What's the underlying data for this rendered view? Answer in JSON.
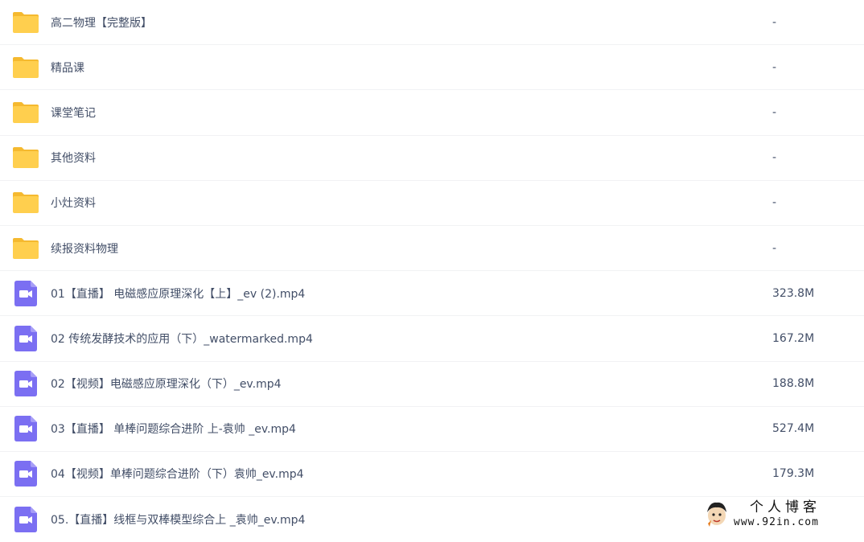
{
  "files": [
    {
      "type": "folder",
      "name": "高二物理【完整版】",
      "size": "-"
    },
    {
      "type": "folder",
      "name": "精品课",
      "size": "-"
    },
    {
      "type": "folder",
      "name": "课堂笔记",
      "size": "-"
    },
    {
      "type": "folder",
      "name": "其他资料",
      "size": "-"
    },
    {
      "type": "folder",
      "name": "小灶资料",
      "size": "-"
    },
    {
      "type": "folder",
      "name": "续报资料物理",
      "size": "-"
    },
    {
      "type": "video",
      "name": "01【直播】 电磁感应原理深化【上】_ev (2).mp4",
      "size": "323.8M"
    },
    {
      "type": "video",
      "name": "02 传统发酵技术的应用（下）_watermarked.mp4",
      "size": "167.2M"
    },
    {
      "type": "video",
      "name": "02【视频】电磁感应原理深化（下）_ev.mp4",
      "size": "188.8M"
    },
    {
      "type": "video",
      "name": "03【直播】 单棒问题综合进阶 上-袁帅 _ev.mp4",
      "size": "527.4M"
    },
    {
      "type": "video",
      "name": "04【视频】单棒问题综合进阶（下）袁帅_ev.mp4",
      "size": "179.3M"
    },
    {
      "type": "video",
      "name": "05.【直播】线框与双棒模型综合上 _袁帅_ev.mp4",
      "size": ""
    }
  ],
  "icons": {
    "folder": "folder-icon",
    "video": "video-file-icon"
  },
  "colors": {
    "folder": "#ffcf4e",
    "folder_back": "#f5b92f",
    "video": "#7b6ff2",
    "text": "#424e67",
    "divider": "#f1f2f4"
  },
  "watermark": {
    "title": "个人博客",
    "url": "www.92in.com"
  }
}
